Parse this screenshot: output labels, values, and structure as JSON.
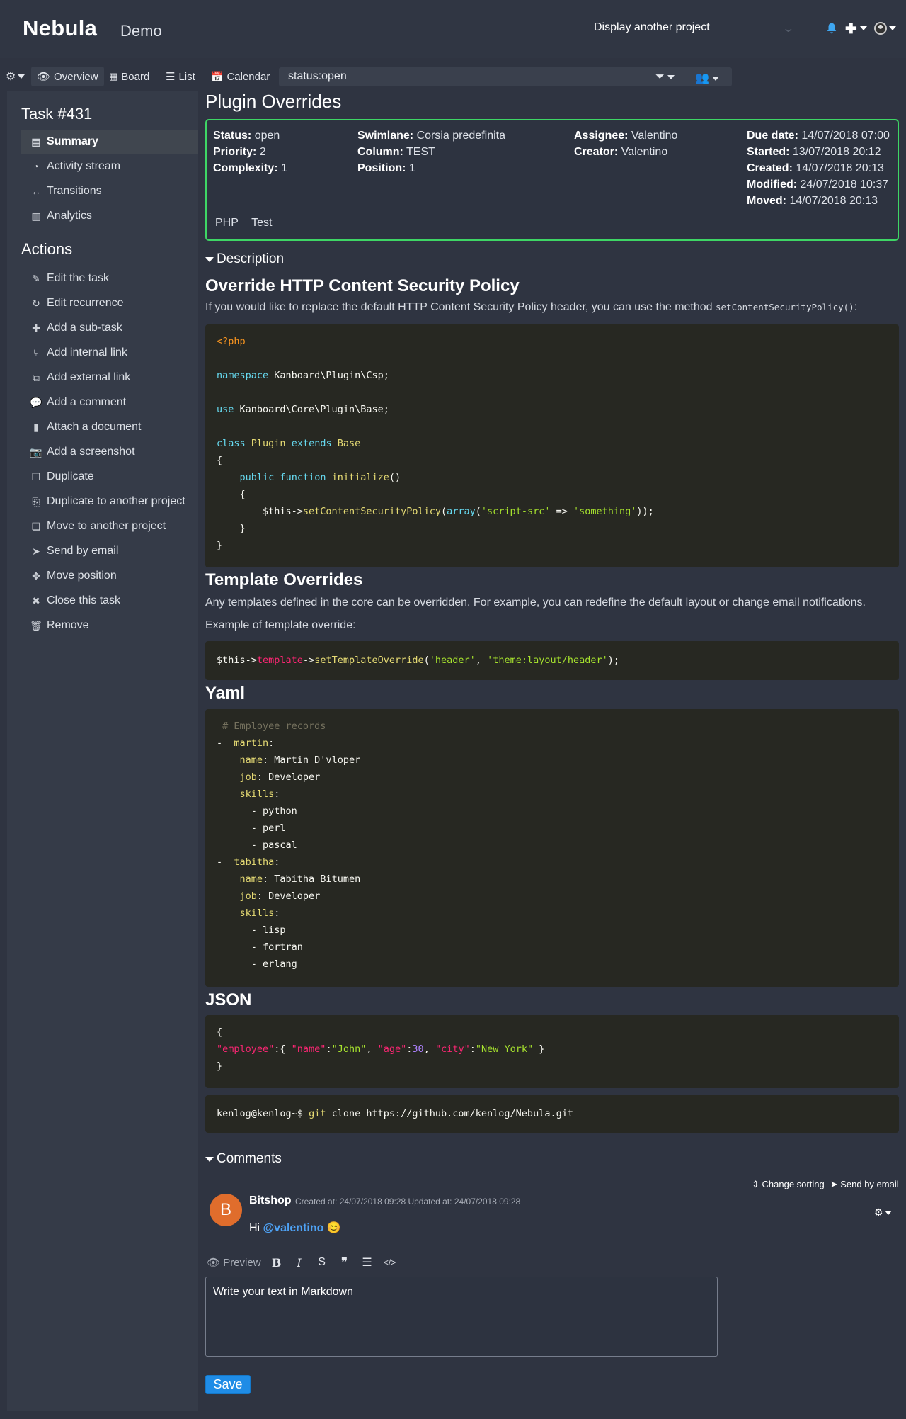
{
  "header": {
    "logo": "Nebula",
    "project": "Demo",
    "project_selector": "Display another project"
  },
  "toolbar": {
    "overview": "Overview",
    "board": "Board",
    "list": "List",
    "calendar": "Calendar",
    "filter_value": "status:open"
  },
  "sidebar": {
    "task_title": "Task #431",
    "nav": [
      {
        "label": "Summary",
        "icon": "summary-icon"
      },
      {
        "label": "Activity stream",
        "icon": "dashboard-icon"
      },
      {
        "label": "Transitions",
        "icon": "arrows-h-icon"
      },
      {
        "label": "Analytics",
        "icon": "bar-chart-icon"
      }
    ],
    "actions_title": "Actions",
    "actions": [
      {
        "label": "Edit the task",
        "icon": "edit-icon"
      },
      {
        "label": "Edit recurrence",
        "icon": "refresh-icon"
      },
      {
        "label": "Add a sub-task",
        "icon": "plus-icon"
      },
      {
        "label": "Add internal link",
        "icon": "code-fork-icon"
      },
      {
        "label": "Add external link",
        "icon": "external-link-icon"
      },
      {
        "label": "Add a comment",
        "icon": "comment-icon"
      },
      {
        "label": "Attach a document",
        "icon": "file-icon"
      },
      {
        "label": "Add a screenshot",
        "icon": "camera-icon"
      },
      {
        "label": "Duplicate",
        "icon": "files-icon"
      },
      {
        "label": "Duplicate to another project",
        "icon": "copy-icon"
      },
      {
        "label": "Move to another project",
        "icon": "clone-icon"
      },
      {
        "label": "Send by email",
        "icon": "paper-plane-icon"
      },
      {
        "label": "Move position",
        "icon": "arrows-icon"
      },
      {
        "label": "Close this task",
        "icon": "times-icon"
      },
      {
        "label": "Remove",
        "icon": "trash-icon"
      }
    ]
  },
  "task": {
    "title": "Plugin Overrides",
    "status_label": "Status:",
    "status": "open",
    "priority_label": "Priority:",
    "priority": "2",
    "complexity_label": "Complexity:",
    "complexity": "1",
    "swimlane_label": "Swimlane:",
    "swimlane": "Corsia predefinita",
    "column_label": "Column:",
    "column": "TEST",
    "position_label": "Position:",
    "position": "1",
    "assignee_label": "Assignee:",
    "assignee": "Valentino",
    "creator_label": "Creator:",
    "creator": "Valentino",
    "due_label": "Due date:",
    "due": "14/07/2018 07:00",
    "started_label": "Started:",
    "started": "13/07/2018 20:12",
    "created_label": "Created:",
    "created": "14/07/2018 20:13",
    "modified_label": "Modified:",
    "modified": "24/07/2018 10:37",
    "moved_label": "Moved:",
    "moved": "14/07/2018 20:13",
    "tags": [
      "PHP",
      "Test"
    ],
    "border_color": "#3ed665"
  },
  "description": {
    "section_label": "Description",
    "h1": "Override HTTP Content Security Policy",
    "p1": "If you would like to replace the default HTTP Content Security Policy header, you can use the method",
    "p1_code": "setContentSecurityPolicy()",
    "p1_end": ":",
    "h2": "Template Overrides",
    "p2": "Any templates defined in the core can be overridden. For example, you can redefine the default layout or change email notifications.",
    "p3": "Example of template override:",
    "h3": "Yaml",
    "h4": "JSON",
    "git_prompt": "kenlog@kenlog~$",
    "git_cmd": "git",
    "git_rest": "clone https://github.com/kenlog/Nebula.git"
  },
  "comments": {
    "section_label": "Comments",
    "change_sorting": "Change sorting",
    "send_email": "Send by email",
    "author": "Bitshop",
    "author_initial": "B",
    "meta": "Created at: 24/07/2018 09:28 Updated at: 24/07/2018 09:28",
    "text_prefix": "Hi",
    "mention": "@valentino",
    "emoji": "😊",
    "preview": "Preview",
    "placeholder": "Write your text in Markdown",
    "save": "Save"
  }
}
